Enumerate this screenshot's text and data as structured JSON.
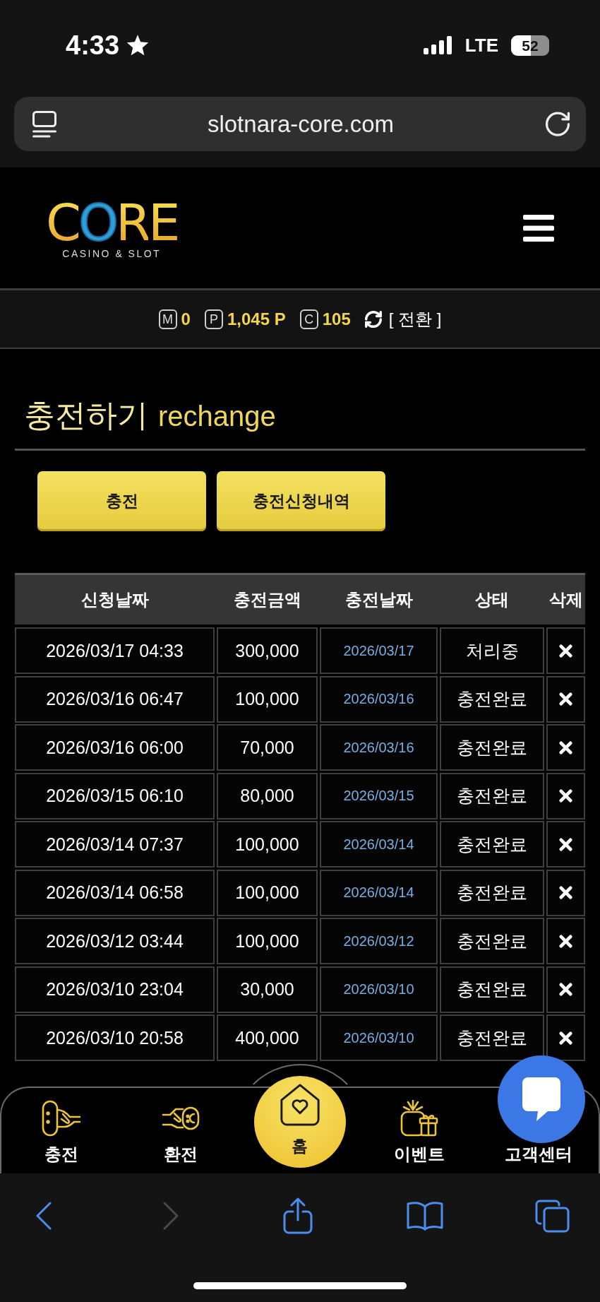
{
  "status_bar": {
    "time": "4:33",
    "network": "LTE",
    "battery": "52"
  },
  "browser": {
    "url": "slotnara-core.com"
  },
  "header": {
    "logo": {
      "wordmark": "CORE",
      "tagline": "CASINO & SLOT"
    }
  },
  "balance_bar": {
    "items": [
      {
        "badge": "M",
        "value": "0"
      },
      {
        "badge": "P",
        "value": "1,045 P"
      },
      {
        "badge": "C",
        "value": "105"
      }
    ],
    "convert_link": "[ 전환 ]"
  },
  "page_title": {
    "korean": "충전하기",
    "english": "rechange"
  },
  "action_buttons": [
    {
      "label": "충전"
    },
    {
      "label": "충전신청내역"
    }
  ],
  "table": {
    "columns": [
      "신청날짜",
      "충전금액",
      "충전날짜",
      "상태",
      "삭제"
    ],
    "rows": [
      {
        "requested": "2026/03/17 04:33",
        "amount": "300,000",
        "charged_date": "2026/03/17",
        "status": "처리중"
      },
      {
        "requested": "2026/03/16 06:47",
        "amount": "100,000",
        "charged_date": "2026/03/16",
        "status": "충전완료"
      },
      {
        "requested": "2026/03/16 06:00",
        "amount": "70,000",
        "charged_date": "2026/03/16",
        "status": "충전완료"
      },
      {
        "requested": "2026/03/15 06:10",
        "amount": "80,000",
        "charged_date": "2026/03/15",
        "status": "충전완료"
      },
      {
        "requested": "2026/03/14 07:37",
        "amount": "100,000",
        "charged_date": "2026/03/14",
        "status": "충전완료"
      },
      {
        "requested": "2026/03/14 06:58",
        "amount": "100,000",
        "charged_date": "2026/03/14",
        "status": "충전완료"
      },
      {
        "requested": "2026/03/12 03:44",
        "amount": "100,000",
        "charged_date": "2026/03/12",
        "status": "충전완료"
      },
      {
        "requested": "2026/03/10 23:04",
        "amount": "30,000",
        "charged_date": "2026/03/10",
        "status": "충전완료"
      },
      {
        "requested": "2026/03/10 20:58",
        "amount": "400,000",
        "charged_date": "2026/03/10",
        "status": "충전완료"
      }
    ]
  },
  "bottom_nav": {
    "items": [
      {
        "label": "충전",
        "kind": "tab"
      },
      {
        "label": "환전",
        "kind": "tab"
      },
      {
        "label": "홈",
        "kind": "home"
      },
      {
        "label": "이벤트",
        "kind": "tab"
      },
      {
        "label": "고객센터",
        "kind": "tab"
      }
    ]
  },
  "browser_toolbar": {
    "buttons": [
      {
        "kind": "back",
        "disabled": false
      },
      {
        "kind": "forward",
        "disabled": true
      },
      {
        "kind": "share",
        "disabled": false
      },
      {
        "kind": "bookmarks",
        "disabled": false
      },
      {
        "kind": "tabs",
        "disabled": false
      }
    ]
  }
}
